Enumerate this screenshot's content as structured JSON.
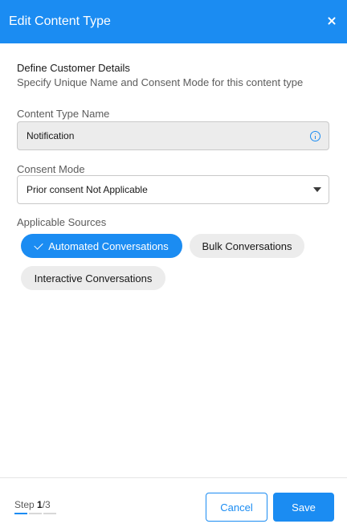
{
  "header": {
    "title": "Edit Content Type",
    "close_icon": "close-icon"
  },
  "section": {
    "title": "Define Customer Details",
    "subtitle": "Specify Unique Name and Consent Mode for this content type"
  },
  "content_type_name": {
    "label": "Content Type Name",
    "value": "Notification",
    "icon": "info-icon"
  },
  "consent_mode": {
    "label": "Consent Mode",
    "selected": "Prior consent Not Applicable",
    "icon": "chevron-down-icon"
  },
  "applicable_sources": {
    "label": "Applicable Sources",
    "items": [
      {
        "label": "Automated Conversations",
        "selected": true
      },
      {
        "label": "Bulk Conversations",
        "selected": false
      },
      {
        "label": "Interactive Conversations",
        "selected": false
      }
    ]
  },
  "footer": {
    "step_label": "Step",
    "step_current": "1",
    "step_total": "/3",
    "cancel_label": "Cancel",
    "save_label": "Save"
  },
  "colors": {
    "accent": "#1b8cf2",
    "pill_unselected": "#ececec"
  }
}
